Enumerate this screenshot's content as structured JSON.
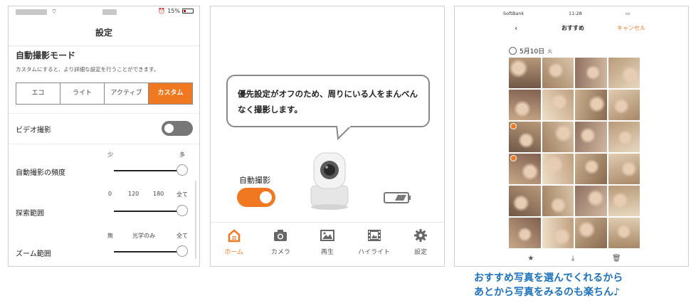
{
  "settings": {
    "status_battery": "15%",
    "header_title": "設定",
    "section_title": "自動撮影モード",
    "description": "カスタムにすると、より詳細な設定を行うことができます。",
    "modes": [
      "エコ",
      "ライト",
      "アクティブ",
      "カスタム"
    ],
    "active_mode": "カスタム",
    "video_label": "ビデオ撮影",
    "video_enabled": false,
    "frequency": {
      "label": "自動撮影の頻度",
      "min_label": "少",
      "max_label": "多",
      "value": 1.0
    },
    "search_range": {
      "label": "探索範囲",
      "ticks": [
        "0",
        "120",
        "180",
        "全て"
      ],
      "value": 1.0
    },
    "zoom_range": {
      "label": "ズーム範囲",
      "ticks": [
        "無",
        "光学のみ",
        "全て"
      ],
      "value": 1.0
    }
  },
  "home": {
    "bubble_text": "優先設定がオフのため、周りにいる人をまんべんなく撮影します。",
    "auto_label": "自動撮影",
    "auto_enabled": true,
    "tabs": [
      {
        "label": "ホーム",
        "icon": "home-icon",
        "active": true
      },
      {
        "label": "カメラ",
        "icon": "camera-icon",
        "active": false
      },
      {
        "label": "再生",
        "icon": "image-icon",
        "active": false
      },
      {
        "label": "ハイライト",
        "icon": "film-icon",
        "active": false
      },
      {
        "label": "設定",
        "icon": "gear-icon",
        "active": false
      }
    ],
    "accent": "#f07820"
  },
  "photos": {
    "status_left": "SoftBank",
    "status_time": "11:28",
    "back_glyph": "‹",
    "title": "おすすめ",
    "cancel_label": "キャンセル",
    "date_label": "5月10日",
    "weekday": "火",
    "star_icon": "★",
    "download_icon": "⤓",
    "trash_icon": "🗑"
  },
  "caption": {
    "line1": "おすすめ写真を選んでくれるから",
    "line2": "あとから写真をみるのも楽ちん♪",
    "color": "#1e73be"
  }
}
